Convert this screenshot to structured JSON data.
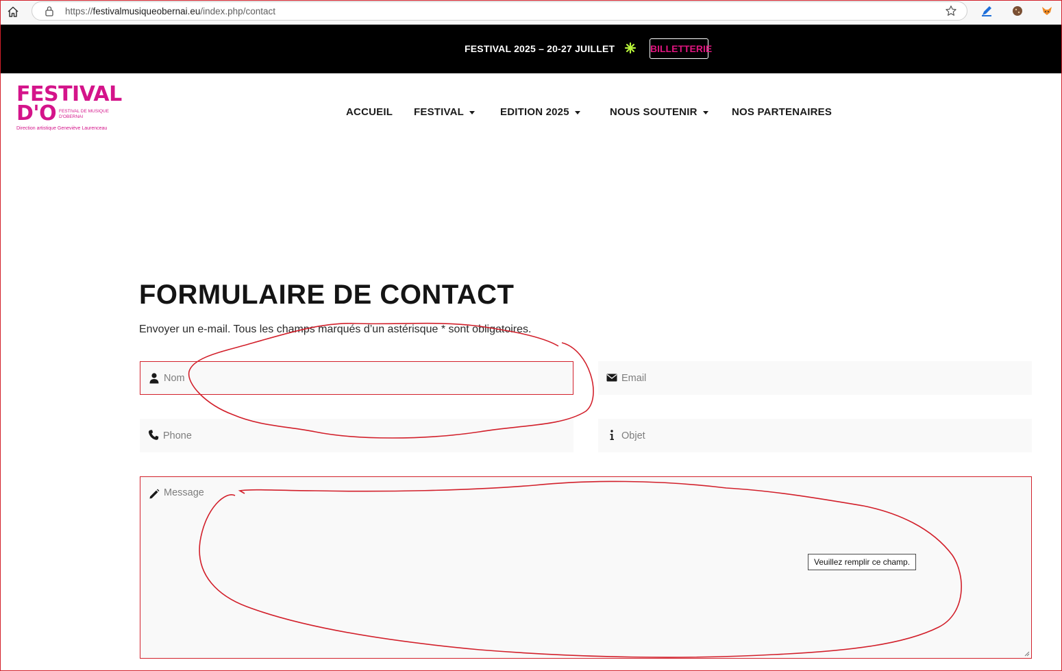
{
  "browser": {
    "url_scheme": "https://",
    "url_host": "festivalmusiqueobernai.eu",
    "url_path": "/index.php/contact"
  },
  "banner": {
    "dates": "FESTIVAL 2025 – 20-27 JUILLET",
    "ticket_button": "BILLETTERIE"
  },
  "logo": {
    "line1": "FESTIVAL",
    "line2": "D'O",
    "subtitle": "FESTIVAL DE MUSIQUE D'OBERNAI",
    "direction": "Direction artistique Geneviève Laurenceau"
  },
  "nav": {
    "items": [
      {
        "label": "ACCUEIL"
      },
      {
        "label": "FESTIVAL"
      },
      {
        "label": "EDITION 2025"
      },
      {
        "label": "NOUS SOUTENIR"
      },
      {
        "label": "NOS PARTENAIRES"
      }
    ]
  },
  "contact": {
    "title": "FORMULAIRE DE CONTACT",
    "intro": "Envoyer un e-mail. Tous les champs marqués d’un astérisque * sont obligatoires.",
    "fields": {
      "name_placeholder": "Nom",
      "email_placeholder": "Email",
      "phone_placeholder": "Phone",
      "subject_placeholder": "Objet",
      "message_placeholder": "Message"
    },
    "validation_tooltip": "Veuillez remplir ce champ."
  },
  "colors": {
    "brand_pink": "#d4148a",
    "annotation_red": "#d21f2a",
    "sparkle_green": "#b6f23a"
  },
  "icons": [
    "home-icon",
    "lock-icon",
    "star-icon",
    "user-icon",
    "envelope-icon",
    "phone-icon",
    "info-icon",
    "pencil-icon",
    "sparkle-icon"
  ]
}
